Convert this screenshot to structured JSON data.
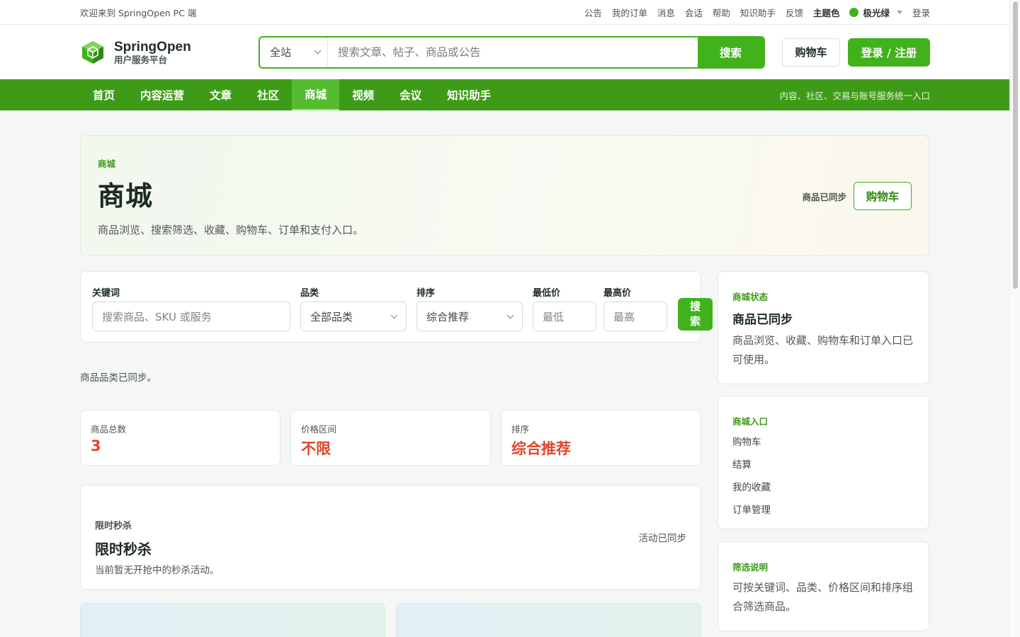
{
  "topbar": {
    "welcome": "欢迎来到 SpringOpen PC 端",
    "links": [
      "公告",
      "我的订单",
      "消息",
      "会话",
      "帮助",
      "知识助手",
      "反馈"
    ],
    "theme_label": "主题色",
    "theme_value": "极光绿",
    "theme_color": "#41b21c",
    "login": "登录"
  },
  "header": {
    "brand_name": "SpringOpen",
    "brand_sub": "用户服务平台",
    "search_scope": "全站",
    "search_placeholder": "搜索文章、帖子、商品或公告",
    "search_button": "搜索",
    "cart_button": "购物车",
    "login_button": "登录 / 注册"
  },
  "nav": {
    "items": [
      "首页",
      "内容运营",
      "文章",
      "社区",
      "商城",
      "视频",
      "会议",
      "知识助手"
    ],
    "active": "商城",
    "tagline": "内容、社区、交易与账号服务统一入口"
  },
  "hero": {
    "kicker": "商城",
    "title": "商城",
    "description": "商品浏览、搜索筛选、收藏、购物车、订单和支付入口。",
    "status": "商品已同步",
    "cart_button": "购物车"
  },
  "filter": {
    "keyword_label": "关键词",
    "keyword_placeholder": "搜索商品、SKU 或服务",
    "category_label": "品类",
    "category_value": "全部品类",
    "sort_label": "排序",
    "sort_value": "综合推荐",
    "min_label": "最低价",
    "min_placeholder": "最低",
    "max_label": "最高价",
    "max_placeholder": "最高",
    "search_button_line1": "搜",
    "search_button_line2": "索"
  },
  "category_sync": "商品品类已同步。",
  "stats": [
    {
      "label": "商品总数",
      "value": "3"
    },
    {
      "label": "价格区间",
      "value": "不限"
    },
    {
      "label": "排序",
      "value": "综合推荐"
    }
  ],
  "flash_sale": {
    "kicker": "限时秒杀",
    "title": "限时秒杀",
    "description": "当前暂无开抢中的秒杀活动。",
    "status": "活动已同步"
  },
  "sidebar": {
    "status_card": {
      "kicker": "商城状态",
      "title": "商品已同步",
      "text": "商品浏览、收藏、购物车和订单入口已可使用。"
    },
    "entry_card": {
      "kicker": "商城入口",
      "links": [
        "购物车",
        "结算",
        "我的收藏",
        "订单管理"
      ]
    },
    "help_card": {
      "kicker": "筛选说明",
      "text": "可按关键词、品类、价格区间和排序组合筛选商品。"
    }
  }
}
